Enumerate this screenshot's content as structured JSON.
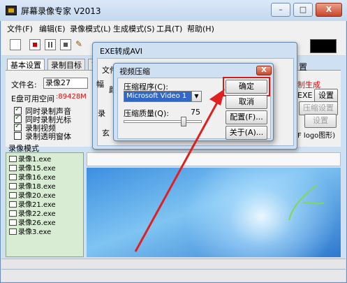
{
  "window": {
    "title": "屏幕录像专家 V2013"
  },
  "title_buttons": {
    "minimize": "–",
    "maximize": "□",
    "close": "X"
  },
  "menu": [
    "文件(F)",
    "编辑(E)",
    "录像模式(L)",
    "生成模式(S)",
    "工具(T)",
    "帮助(H)"
  ],
  "tabs": [
    "基本设置",
    "录制目标",
    "首"
  ],
  "basic": {
    "filename_label": "文件名:",
    "filename_value": "录像27",
    "disk_label": "E盘可用空间",
    "disk_value": ":89428M",
    "checks": [
      {
        "label": "同时录制声音",
        "checked": true
      },
      {
        "label": "同时录制光标",
        "checked": true
      },
      {
        "label": "录制视频",
        "checked": true
      },
      {
        "label": "录制透明窗体",
        "checked": false
      }
    ]
  },
  "right_fragments": {
    "browse_tail": "览",
    "settings_tab": "置",
    "gen_label": "制生成",
    "exe_label": "EXE",
    "exe_settings": "设置",
    "compress_settings": "压缩设置",
    "settings_btn": "设置",
    "logo_label": "F logo图形)"
  },
  "list": {
    "title": "录像模式",
    "items": [
      "录像1.exe",
      "录像15.exe",
      "录像16.exe",
      "录像18.exe",
      "录像20.exe",
      "录像21.exe",
      "录像22.exe",
      "录像26.exe",
      "录像3.exe"
    ]
  },
  "exe_dialog": {
    "title": "EXE转成AVI",
    "file_label": "文件",
    "group_label_1": "颜",
    "group_label_2": "录",
    "side_label": "幅",
    "bottom_label": "玄"
  },
  "compress_dialog": {
    "title": "视频压缩",
    "close": "X",
    "program_label": "压缩程序(C):",
    "program_value": "Microsoft Video 1",
    "quality_label": "压缩质量(Q):",
    "quality_value": "75",
    "buttons": {
      "ok": "确定",
      "cancel": "取消",
      "config": "配置(F)...",
      "about": "关于(A)..."
    }
  },
  "colors": {
    "highlight": "#d71a1a",
    "arrow": "#e02020",
    "list_bg": "#d7ecd3"
  }
}
